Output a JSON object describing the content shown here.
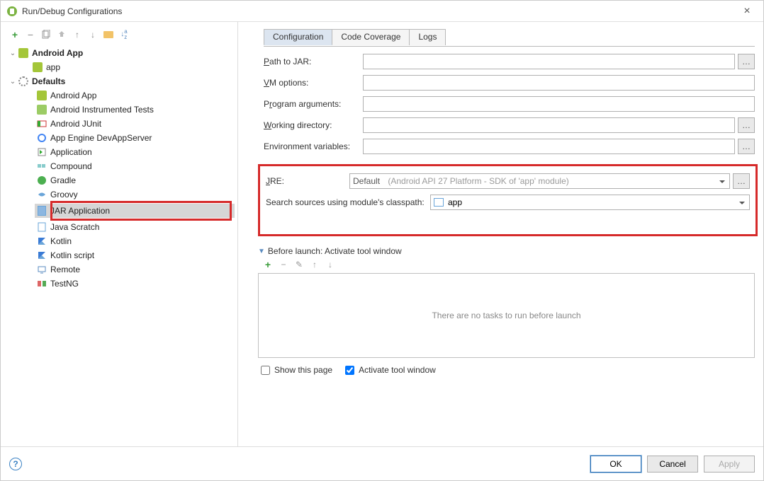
{
  "window": {
    "title": "Run/Debug Configurations"
  },
  "tree": {
    "nodes": {
      "android_app": "Android App",
      "app": "app",
      "defaults": "Defaults",
      "d_android_app": "Android App",
      "d_instrumented": "Android Instrumented Tests",
      "d_junit": "Android JUnit",
      "d_appengine": "App Engine DevAppServer",
      "d_application": "Application",
      "d_compound": "Compound",
      "d_gradle": "Gradle",
      "d_groovy": "Groovy",
      "d_jar": "JAR Application",
      "d_javascratch": "Java Scratch",
      "d_kotlin": "Kotlin",
      "d_kotlinscript": "Kotlin script",
      "d_remote": "Remote",
      "d_testng": "TestNG"
    }
  },
  "tabs": {
    "configuration": "Configuration",
    "code_coverage": "Code Coverage",
    "logs": "Logs"
  },
  "form": {
    "path_to_jar_label_pre": "",
    "path_to_jar": "Path to JAR:",
    "path_to_jar_underline": "P",
    "vm_options": "VM options:",
    "vm_opt_underline": "V",
    "program_args": "Program arguments:",
    "prog_underline": "r",
    "working_dir": "Working directory:",
    "work_underline": "W",
    "env_vars": "Environment variables:",
    "jre_label": "JRE:",
    "jre_underline": "J",
    "jre_value": "Default",
    "jre_hint": "(Android API 27 Platform - SDK of 'app' module)",
    "classpath_label": "Search sources using module's classpath:",
    "classpath_value": "app"
  },
  "before_launch": {
    "title": "Before launch: Activate tool window",
    "underline": "B",
    "empty_text": "There are no tasks to run before launch"
  },
  "checks": {
    "show_page": "Show this page",
    "activate_window": "Activate tool window"
  },
  "buttons": {
    "ok": "OK",
    "cancel": "Cancel",
    "apply": "Apply"
  }
}
